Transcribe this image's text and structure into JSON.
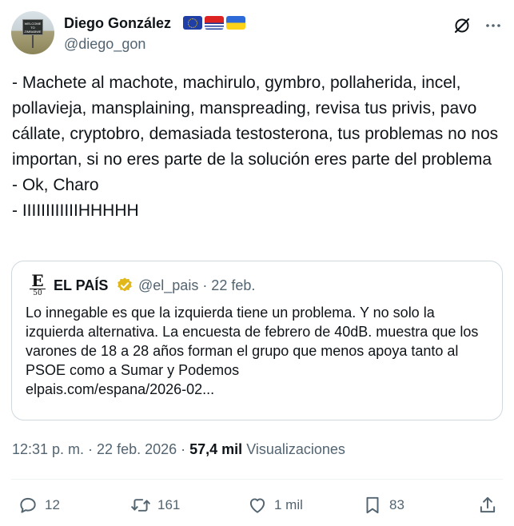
{
  "author": {
    "name": "Diego González",
    "handle": "@diego_gon",
    "avatar_sign": "WELCOME TO ZIMBABWE"
  },
  "flags": [
    "eu-flag-icon",
    "kiribati-flag-icon",
    "ukraine-flag-icon"
  ],
  "tweet": {
    "text": "- Machete al machote, machirulo, gymbro, pollaherida, incel, pollavieja, mansplaining, manspreading, revisa tus privis, pavo cállate, cryptobro, demasiada testosterona, tus problemas no nos importan, si no eres parte de la solución eres parte del problema\n- Ok, Charo\n- IIIIIIIIIIIIHHHHH"
  },
  "quote": {
    "logo_letter": "E",
    "logo_number": "50",
    "name": "EL PAÍS",
    "handle_date": "@el_pais · 22 feb.",
    "text": "Lo innegable es que la izquierda tiene un problema. Y no solo la izquierda alternativa. La encuesta de febrero de 40dB. muestra que los varones de 18 a 28 años forman el grupo que menos apoya tanto al PSOE como a Sumar y Podemos\nelpais.com/espana/2026-02..."
  },
  "meta": {
    "time_date": "12:31 p. m. · 22 feb. 2026 · ",
    "views_count": "57,4 mil",
    "views_label": " Visualizaciones"
  },
  "actions": {
    "replies": "12",
    "retweets": "161",
    "likes": "1 mil",
    "bookmarks": "83"
  },
  "colors": {
    "text": "#0f1419",
    "secondary": "#536471",
    "border": "#cfd9de",
    "verified_gold": "#e2b719"
  }
}
